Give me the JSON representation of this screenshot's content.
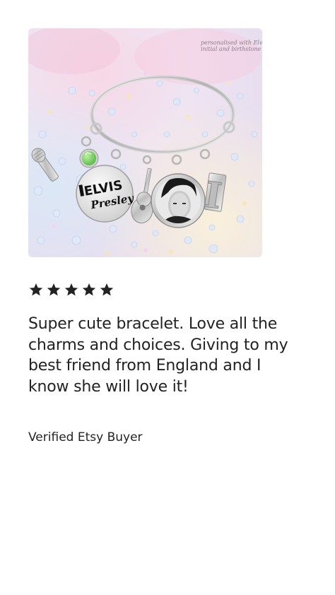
{
  "product_image": {
    "watermark_lines": [
      "personalised with Elvis",
      "initial and birthstone"
    ],
    "charm_text_line1": "ELVIS",
    "charm_text_line2": "Presley",
    "initial_charm_letter": "I",
    "birthstone_color": "#5fbf4a"
  },
  "review": {
    "rating": 5,
    "rating_max": 5,
    "star_icon": "star-icon",
    "star_color": "#222222",
    "text": "Super cute bracelet. Love all the charms and choices. Giving to my best friend from England and I know she will love it!",
    "reviewer": "Verified Etsy Buyer"
  }
}
